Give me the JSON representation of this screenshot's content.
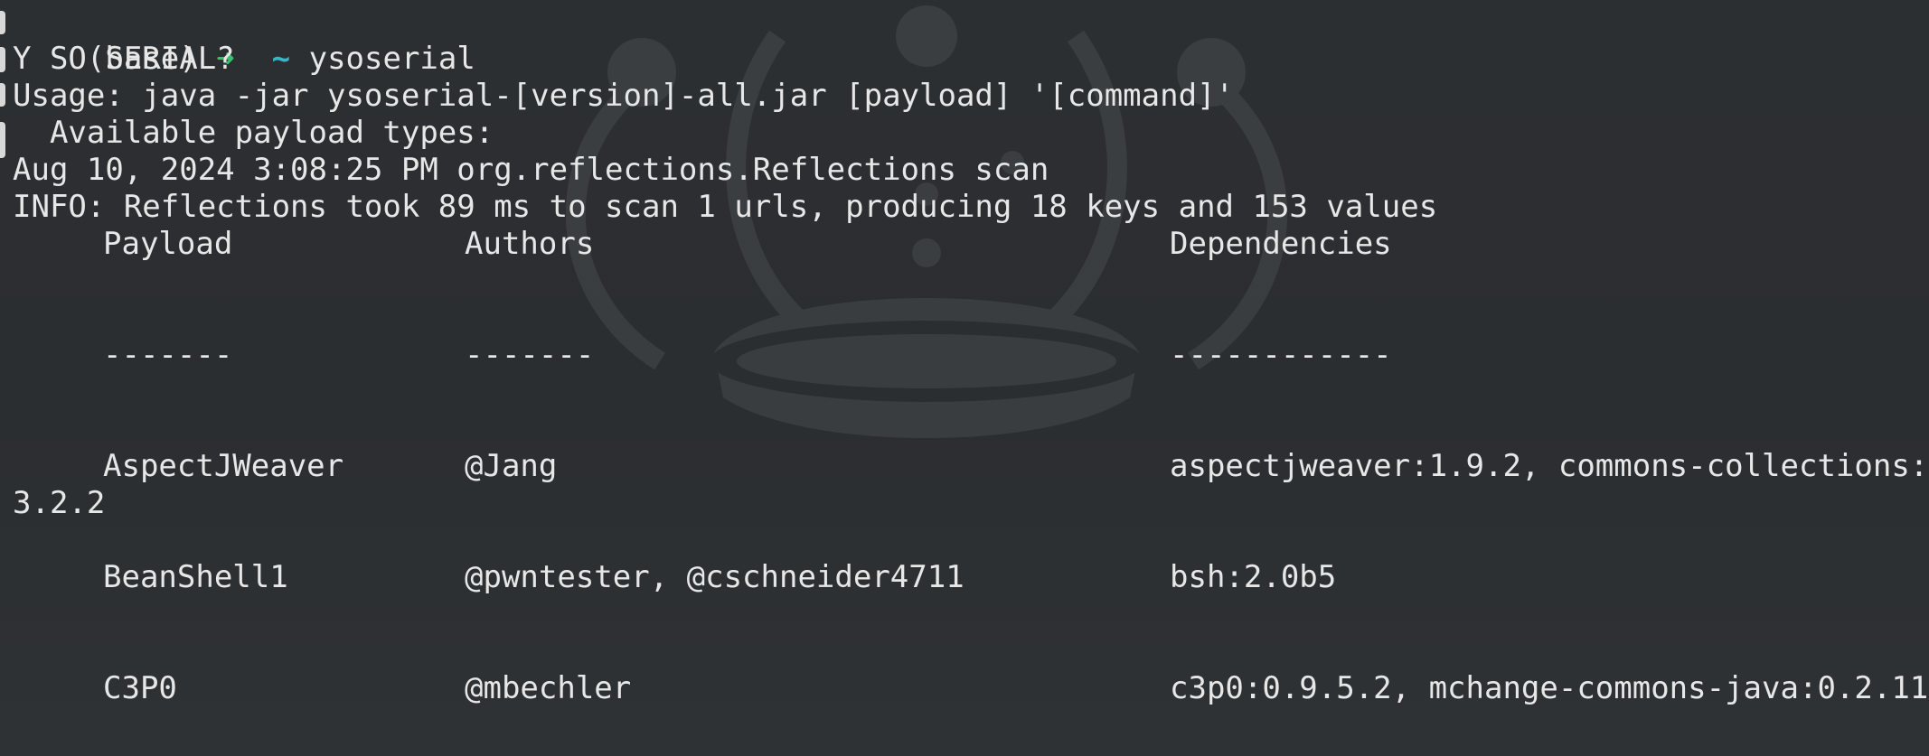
{
  "colors": {
    "background": "#2c2f32",
    "text": "#e7e7e7",
    "prompt_arrow": "#35c26f",
    "prompt_tilde": "#2fb9c9"
  },
  "prompt": {
    "env": "(base)",
    "arrow": "➜",
    "cwd": "~",
    "command": "ysoserial"
  },
  "output": {
    "title": "Y SO SERIAL?",
    "usage": "Usage: java -jar ysoserial-[version]-all.jar [payload] '[command]'",
    "available": "  Available payload types:",
    "log_time": "Aug 10, 2024 3:08:25 PM org.reflections.Reflections scan",
    "log_info": "INFO: Reflections took 89 ms to scan 1 urls, producing 18 keys and 153 values"
  },
  "table": {
    "headers": [
      "Payload",
      "Authors",
      "Dependencies"
    ],
    "separators": [
      "-------",
      "-------",
      "------------"
    ],
    "rows": [
      {
        "payload": "AspectJWeaver",
        "authors": "@Jang",
        "dependencies": "aspectjweaver:1.9.2, commons-collections:",
        "wrap": "3.2.2"
      },
      {
        "payload": "BeanShell1",
        "authors": "@pwntester, @cschneider4711",
        "dependencies": "bsh:2.0b5"
      },
      {
        "payload": "C3P0",
        "authors": "@mbechler",
        "dependencies": "c3p0:0.9.5.2, mchange-commons-java:0.2.11"
      }
    ]
  },
  "icons": {
    "watermark": "crown-watermark-icon"
  }
}
